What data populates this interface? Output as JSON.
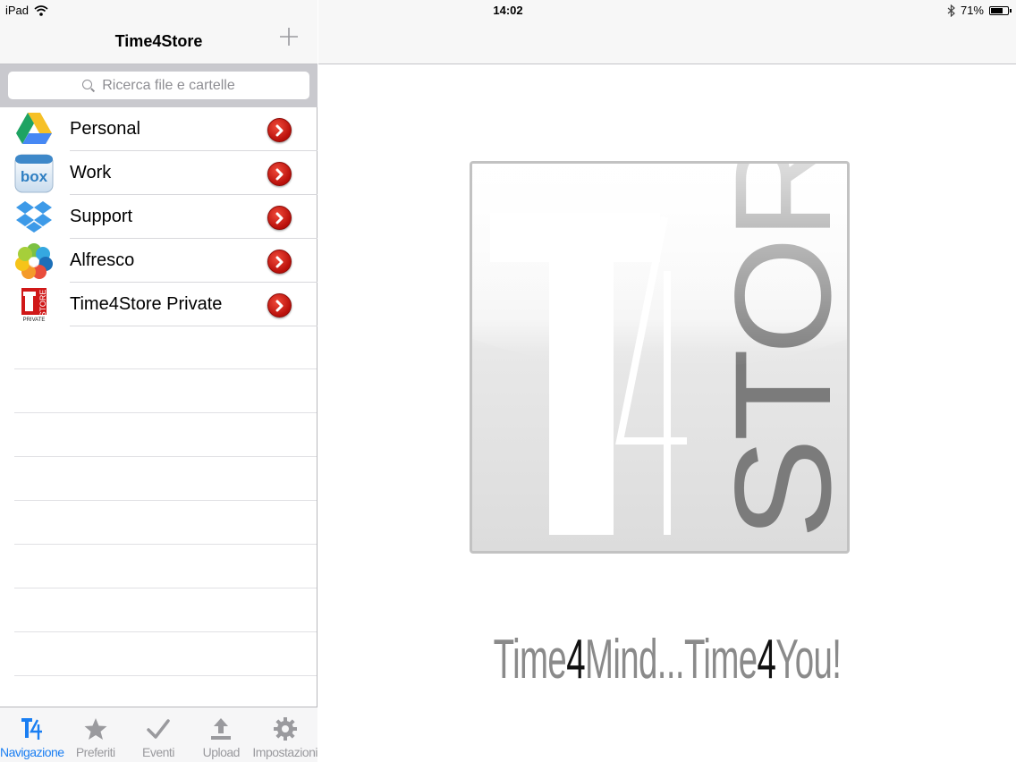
{
  "status_bar": {
    "device": "iPad",
    "time": "14:02",
    "battery": "71%",
    "battery_level": 0.71
  },
  "sidebar": {
    "title": "Time4Store",
    "add_icon": "plus-icon",
    "search_placeholder": "Ricerca file e cartelle",
    "accounts": [
      {
        "label": "Personal",
        "icon": "google-drive-icon"
      },
      {
        "label": "Work",
        "icon": "box-icon"
      },
      {
        "label": "Support",
        "icon": "dropbox-icon"
      },
      {
        "label": "Alfresco",
        "icon": "alfresco-icon"
      },
      {
        "label": "Time4Store Private",
        "icon": "time4store-private-icon"
      }
    ],
    "tabs": [
      {
        "label": "Navigazione",
        "icon": "t4-icon",
        "active": true
      },
      {
        "label": "Preferiti",
        "icon": "star-icon",
        "active": false
      },
      {
        "label": "Eventi",
        "icon": "checkmark-icon",
        "active": false
      },
      {
        "label": "Upload",
        "icon": "upload-icon",
        "active": false
      },
      {
        "label": "Impostazioni",
        "icon": "gear-icon",
        "active": false
      }
    ]
  },
  "main": {
    "logo": {
      "text_t4": "T4",
      "text_store": "STORE"
    },
    "slogan": {
      "part1": "Time",
      "digit1": "4",
      "part2": "Mind...Time",
      "digit2": "4",
      "part3": "You!"
    }
  },
  "colors": {
    "accent": "#1a7ef2",
    "disclosure_red": "#c8140e",
    "inactive_tab": "#9a9a9e"
  }
}
